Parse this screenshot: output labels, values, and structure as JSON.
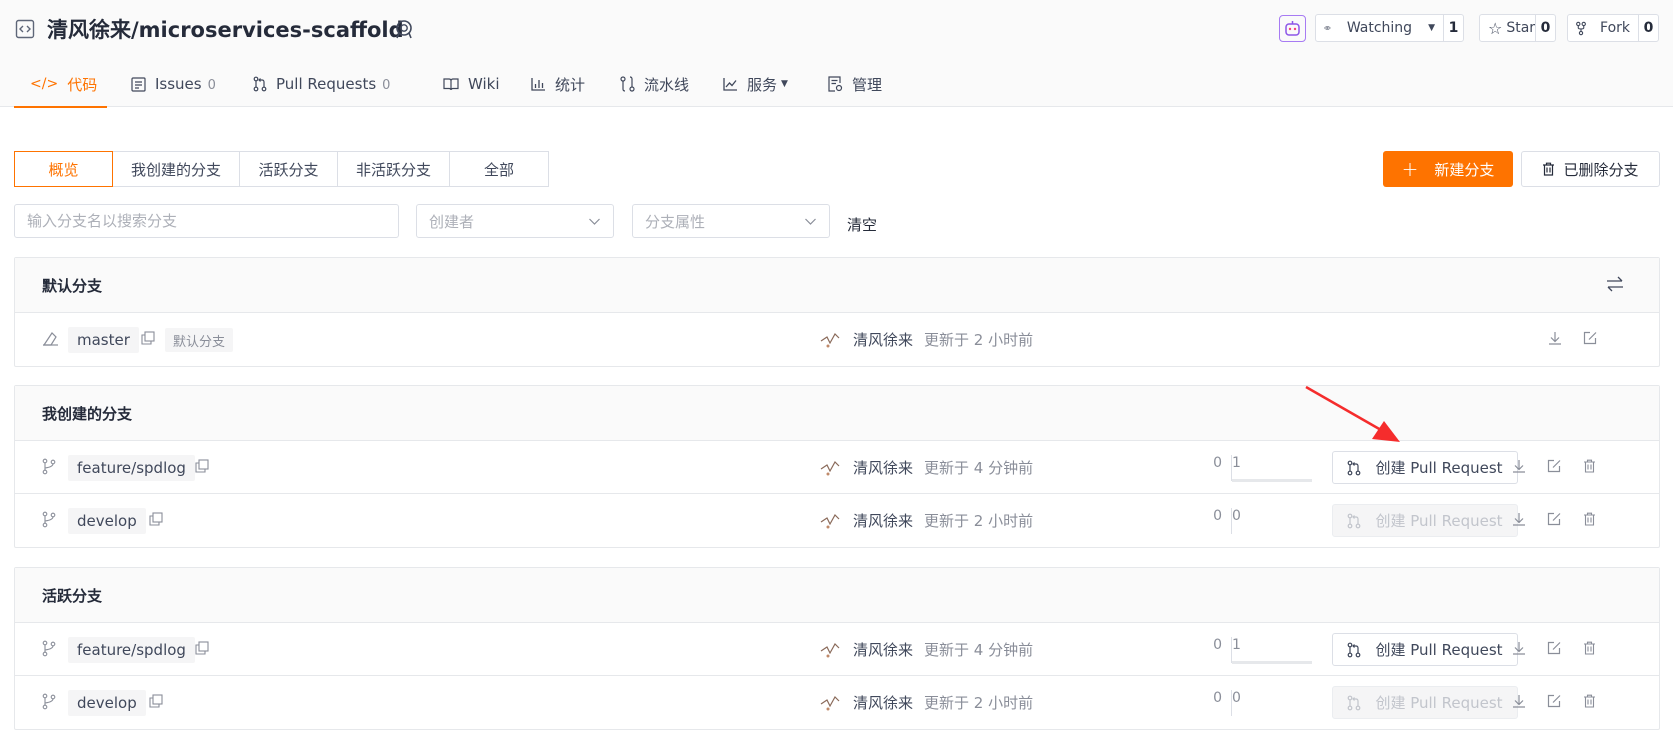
{
  "repo": {
    "title": "清风徐来/microservices-scaffold",
    "watch_label": "Watching",
    "watch_count": "1",
    "star_label": "Star",
    "star_count": "0",
    "fork_label": "Fork",
    "fork_count": "0"
  },
  "tabs": [
    {
      "label": "代码",
      "count": ""
    },
    {
      "label": "Issues",
      "count": "0"
    },
    {
      "label": "Pull Requests",
      "count": "0"
    },
    {
      "label": "Wiki",
      "count": ""
    },
    {
      "label": "统计",
      "count": ""
    },
    {
      "label": "流水线",
      "count": ""
    },
    {
      "label": "服务",
      "count": ""
    },
    {
      "label": "管理",
      "count": ""
    }
  ],
  "filters": {
    "segments": [
      "概览",
      "我创建的分支",
      "活跃分支",
      "非活跃分支",
      "全部"
    ],
    "new_branch": "新建分支",
    "deleted_branches": "已删除分支",
    "search_placeholder": "输入分支名以搜索分支",
    "creator_placeholder": "创建者",
    "attr_placeholder": "分支属性",
    "clear": "清空"
  },
  "sections": [
    {
      "title": "默认分支",
      "rows": [
        {
          "name": "master",
          "tag": "默认分支",
          "author": "清风徐来",
          "updated": "更新于 2 小时前"
        }
      ]
    },
    {
      "title": "我创建的分支",
      "rows": [
        {
          "name": "feature/spdlog",
          "author": "清风徐来",
          "updated": "更新于 4 分钟前",
          "behind": "0",
          "ahead": "1",
          "pr_label": "创建 Pull Request",
          "pr_enabled": true
        },
        {
          "name": "develop",
          "author": "清风徐来",
          "updated": "更新于 2 小时前",
          "behind": "0",
          "ahead": "0",
          "pr_label": "创建 Pull Request",
          "pr_enabled": false
        }
      ]
    },
    {
      "title": "活跃分支",
      "rows": [
        {
          "name": "feature/spdlog",
          "author": "清风徐来",
          "updated": "更新于 4 分钟前",
          "behind": "0",
          "ahead": "1",
          "pr_label": "创建 Pull Request",
          "pr_enabled": true
        },
        {
          "name": "develop",
          "author": "清风徐来",
          "updated": "更新于 2 小时前",
          "behind": "0",
          "ahead": "0",
          "pr_label": "创建 Pull Request",
          "pr_enabled": false
        }
      ]
    }
  ],
  "colors": {
    "accent": "#fe7300",
    "annotation_arrow": "#f52c2c"
  }
}
